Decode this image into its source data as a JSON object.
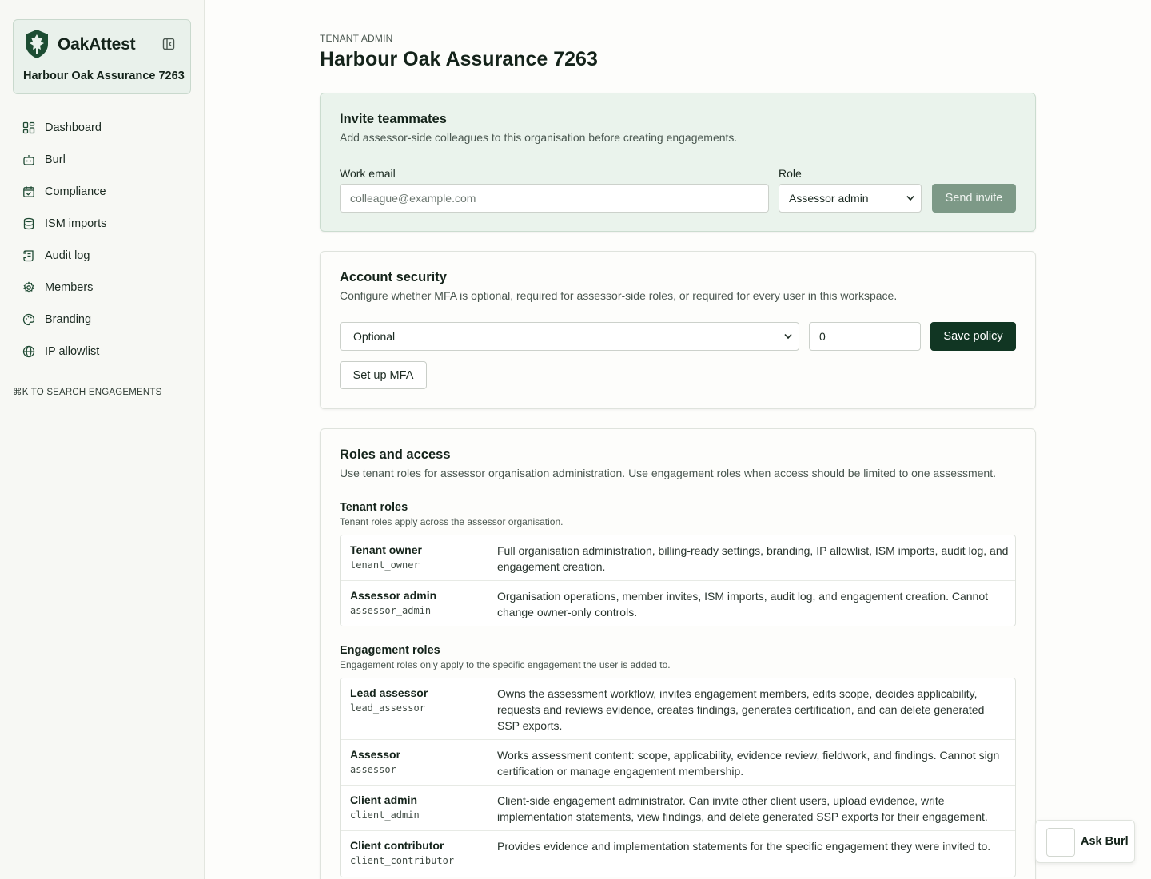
{
  "app": {
    "name": "OakAttest",
    "tenant_name": "Harbour Oak Assurance 7263"
  },
  "sidebar": {
    "items": [
      {
        "label": "Dashboard",
        "icon": "dashboard-icon"
      },
      {
        "label": "Burl",
        "icon": "bot-icon"
      },
      {
        "label": "Compliance",
        "icon": "calendar-check-icon"
      },
      {
        "label": "ISM imports",
        "icon": "database-icon"
      },
      {
        "label": "Audit log",
        "icon": "scroll-icon"
      },
      {
        "label": "Members",
        "icon": "gear-icon"
      },
      {
        "label": "Branding",
        "icon": "palette-icon"
      },
      {
        "label": "IP allowlist",
        "icon": "globe-icon"
      }
    ],
    "search_hint": "⌘K TO SEARCH ENGAGEMENTS"
  },
  "header": {
    "eyebrow": "TENANT ADMIN",
    "title": "Harbour Oak Assurance 7263"
  },
  "invite": {
    "title": "Invite teammates",
    "description": "Add assessor-side colleagues to this organisation before creating engagements.",
    "email_label": "Work email",
    "email_placeholder": "colleague@example.com",
    "role_label": "Role",
    "role_value": "Assessor admin",
    "send_label": "Send invite"
  },
  "security": {
    "title": "Account security",
    "description": "Configure whether MFA is optional, required for assessor-side roles, or required for every user in this workspace.",
    "policy_value": "Optional",
    "grace_value": "0",
    "save_label": "Save policy",
    "setup_label": "Set up MFA"
  },
  "roles": {
    "title": "Roles and access",
    "description": "Use tenant roles for assessor organisation administration. Use engagement roles when access should be limited to one assessment.",
    "tenant": {
      "heading": "Tenant roles",
      "subheading": "Tenant roles apply across the assessor organisation.",
      "rows": [
        {
          "name": "Tenant owner",
          "key": "tenant_owner",
          "description": "Full organisation administration, billing-ready settings, branding, IP allowlist, ISM imports, audit log, and engagement creation."
        },
        {
          "name": "Assessor admin",
          "key": "assessor_admin",
          "description": "Organisation operations, member invites, ISM imports, audit log, and engagement creation. Cannot change owner-only controls."
        }
      ]
    },
    "engagement": {
      "heading": "Engagement roles",
      "subheading": "Engagement roles only apply to the specific engagement the user is added to.",
      "rows": [
        {
          "name": "Lead assessor",
          "key": "lead_assessor",
          "description": "Owns the assessment workflow, invites engagement members, edits scope, decides applicability, requests and reviews evidence, creates findings, generates certification, and can delete generated SSP exports."
        },
        {
          "name": "Assessor",
          "key": "assessor",
          "description": "Works assessment content: scope, applicability, evidence review, fieldwork, and findings. Cannot sign certification or manage engagement membership."
        },
        {
          "name": "Client admin",
          "key": "client_admin",
          "description": "Client-side engagement administrator. Can invite other client users, upload evidence, write implementation statements, view findings, and delete generated SSP exports for their engagement."
        },
        {
          "name": "Client contributor",
          "key": "client_contributor",
          "description": "Provides evidence and implementation statements for the specific engagement they were invited to."
        }
      ]
    }
  },
  "assistant": {
    "label": "Ask Burl"
  },
  "colors": {
    "brand": "#113623",
    "send_disabled": "#7d9987",
    "invite_bg": "#eaf3ec"
  }
}
